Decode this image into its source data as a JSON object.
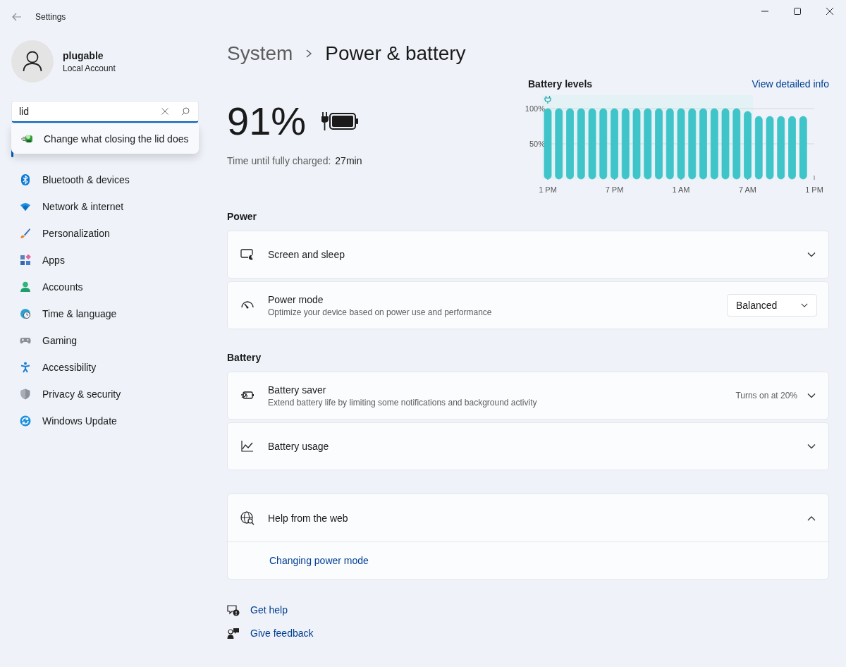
{
  "window": {
    "title": "Settings"
  },
  "user": {
    "name": "plugable",
    "account_type": "Local Account"
  },
  "search": {
    "value": "lid",
    "suggestions": [
      {
        "label": "Change what closing the lid does"
      }
    ]
  },
  "sidebar": {
    "items": [
      {
        "label": "Bluetooth & devices",
        "selected": false
      },
      {
        "label": "Network & internet",
        "selected": false
      },
      {
        "label": "Personalization",
        "selected": false
      },
      {
        "label": "Apps",
        "selected": false
      },
      {
        "label": "Accounts",
        "selected": false
      },
      {
        "label": "Time & language",
        "selected": false
      },
      {
        "label": "Gaming",
        "selected": false
      },
      {
        "label": "Accessibility",
        "selected": false
      },
      {
        "label": "Privacy & security",
        "selected": false
      },
      {
        "label": "Windows Update",
        "selected": false
      }
    ]
  },
  "breadcrumb": [
    "System",
    "Power & battery"
  ],
  "battery": {
    "percent": "91%",
    "charging": true,
    "status_label": "Time until fully charged:",
    "status_value": "27min"
  },
  "battery_levels": {
    "title": "Battery levels",
    "link": "View detailed info",
    "chart_data": {
      "type": "bar",
      "categories": [
        "1 PM",
        null,
        null,
        null,
        null,
        null,
        "7 PM",
        null,
        null,
        null,
        null,
        null,
        "1 AM",
        null,
        null,
        null,
        null,
        null,
        "7 AM",
        null,
        null,
        null,
        null,
        null,
        "1 PM"
      ],
      "series": [
        {
          "color": "#3fc4c9",
          "values": [
            100,
            100,
            100,
            100,
            100,
            100,
            100,
            100,
            100,
            100,
            100,
            100,
            100,
            100,
            100,
            100,
            100,
            100,
            96,
            89,
            89,
            89,
            89,
            89,
            null
          ]
        }
      ],
      "ylim": [
        0,
        100
      ],
      "yticks": [
        {
          "value": 50,
          "label": "50%"
        },
        {
          "value": 100,
          "label": "100%"
        }
      ]
    }
  },
  "sections": [
    {
      "title": "Power",
      "cards": [
        {
          "kind": "expander",
          "title": "Screen and sleep",
          "expanded": false
        },
        {
          "kind": "dropdown",
          "title": "Power mode",
          "description": "Optimize your device based on power use and performance",
          "value": "Balanced"
        }
      ]
    },
    {
      "title": "Battery",
      "cards": [
        {
          "kind": "expander",
          "title": "Battery saver",
          "description": "Extend battery life by limiting some notifications and background activity",
          "status": "Turns on at 20%",
          "expanded": false
        },
        {
          "kind": "expander",
          "title": "Battery usage",
          "expanded": false
        }
      ]
    }
  ],
  "help": {
    "title": "Help from the web",
    "expanded": true,
    "links": [
      "Changing power mode"
    ]
  },
  "footer_links": [
    "Get help",
    "Give feedback"
  ]
}
